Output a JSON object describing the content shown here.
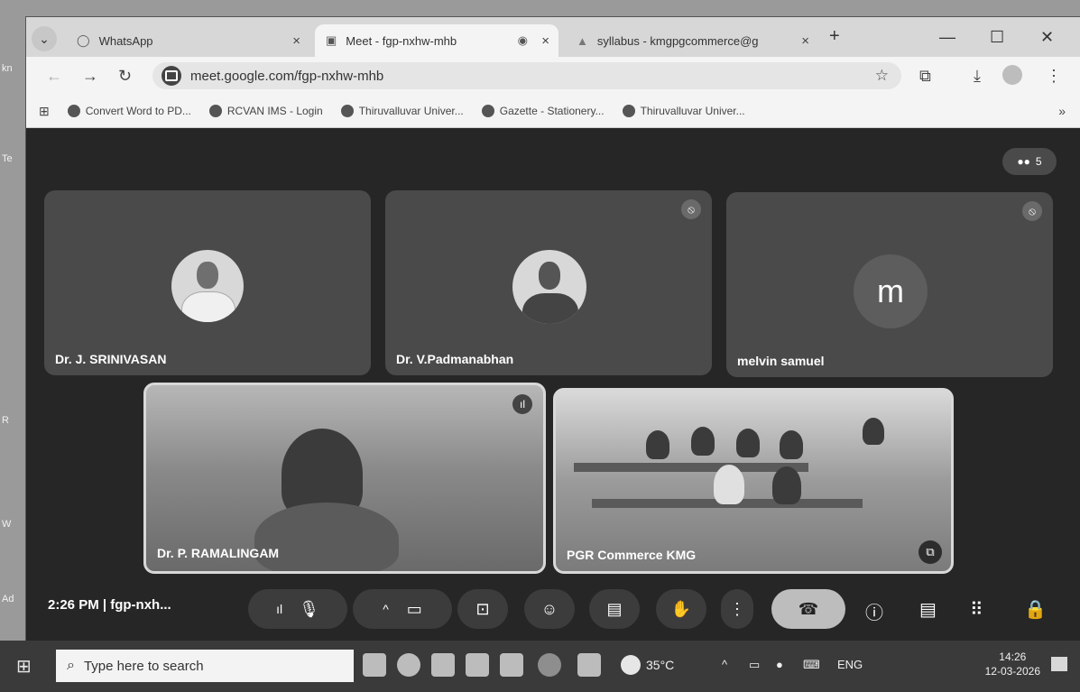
{
  "browser": {
    "tabs": [
      {
        "label": "WhatsApp",
        "active": false
      },
      {
        "label": "Meet - fgp-nxhw-mhb",
        "active": true
      },
      {
        "label": "syllabus - kmgpgcommerce@g",
        "active": false
      }
    ],
    "url": "meet.google.com/fgp-nxhw-mhb",
    "bookmarks": [
      "Convert Word to PD...",
      "RCVAN IMS - Login",
      "Thiruvalluvar Univer...",
      "Gazette - Stationery...",
      "Thiruvalluvar Univer..."
    ],
    "bookmarks_overflow": "»"
  },
  "meet": {
    "participant_count": "5",
    "tiles": [
      {
        "name": "Dr. J. SRINIVASAN",
        "muted": false
      },
      {
        "name": "Dr. V.Padmanabhan",
        "muted": true
      },
      {
        "name": "melvin samuel",
        "muted": true,
        "avatar_letter": "m"
      },
      {
        "name": "Dr. P. RAMALINGAM",
        "muted": false
      },
      {
        "name": "PGR Commerce KMG",
        "muted": false
      }
    ],
    "bottom_bar": {
      "time_and_code": "2:26 PM  |  fgp-nxh..."
    }
  },
  "desktop": {
    "icon_labels": [
      "kn",
      "Te",
      "R",
      "W",
      "Ad"
    ]
  },
  "taskbar": {
    "search_placeholder": "Type here to search",
    "weather": "35°C",
    "language": "ENG",
    "time": "14:26",
    "date": "12-03-2026"
  },
  "colors": {
    "meet_background": "#262626",
    "tile_background": "#4a4a4a"
  }
}
